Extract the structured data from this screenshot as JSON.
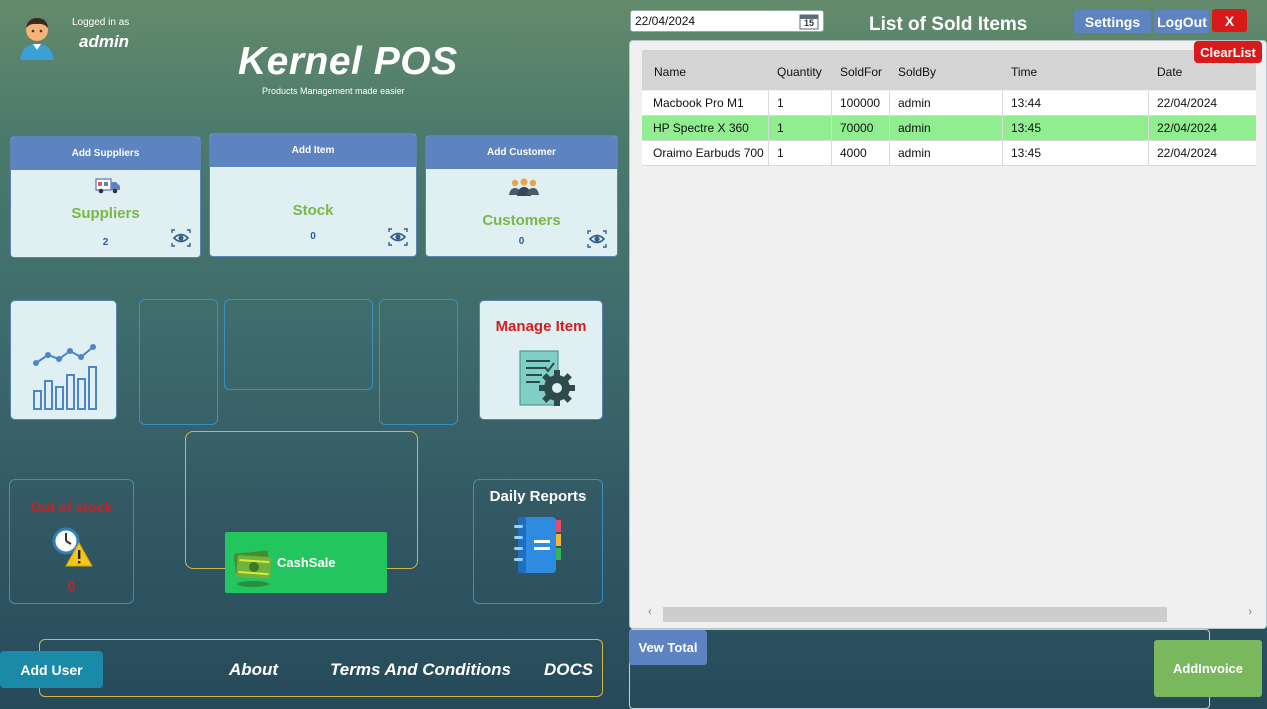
{
  "header": {
    "logged_in_label": "Logged in as",
    "username": "admin",
    "app_title": "Kernel POS",
    "app_subtitle": "Products Management made easier"
  },
  "cards": [
    {
      "button": "Add Suppliers",
      "title": "Suppliers",
      "count": "2"
    },
    {
      "button": "Add Item",
      "title": "Stock",
      "count": "0"
    },
    {
      "button": "Add Customer",
      "title": "Customers",
      "count": "0"
    }
  ],
  "tiles": {
    "manage_item": "Manage Item",
    "out_of_stock": "Out of stock",
    "out_of_stock_count": "0",
    "daily_reports": "Daily Reports",
    "cash_sale": "CashSale"
  },
  "footer": {
    "add_user": "Add User",
    "about": "About",
    "terms": "Terms And Conditions",
    "docs": "DOCS"
  },
  "right": {
    "date": "22/04/2024",
    "calendar_day": "15",
    "list_title": "List of Sold Items",
    "settings": "Settings",
    "logout": "LogOut",
    "close": "X",
    "clear_list": "ClearList",
    "view_total": "Vew Total",
    "add_invoice": "AddInvoice"
  },
  "table": {
    "columns": [
      "Name",
      "Quantity",
      "SoldFor",
      "SoldBy",
      "Time",
      "Date"
    ],
    "rows": [
      [
        "Macbook Pro M1",
        "1",
        "100000",
        "admin",
        "13:44",
        "22/04/2024"
      ],
      [
        "HP Spectre X 360",
        "1",
        "70000",
        "admin",
        "13:45",
        "22/04/2024"
      ],
      [
        "Oraimo Earbuds 700",
        "1",
        "4000",
        "admin",
        "13:45",
        "22/04/2024"
      ]
    ],
    "selected_row": 1
  },
  "colors": {
    "accent_blue": "#5d83c1",
    "danger_red": "#d91a1a",
    "success_green": "#22c55e",
    "selected_row": "#90ee90",
    "card_title_green": "#7ab648"
  }
}
